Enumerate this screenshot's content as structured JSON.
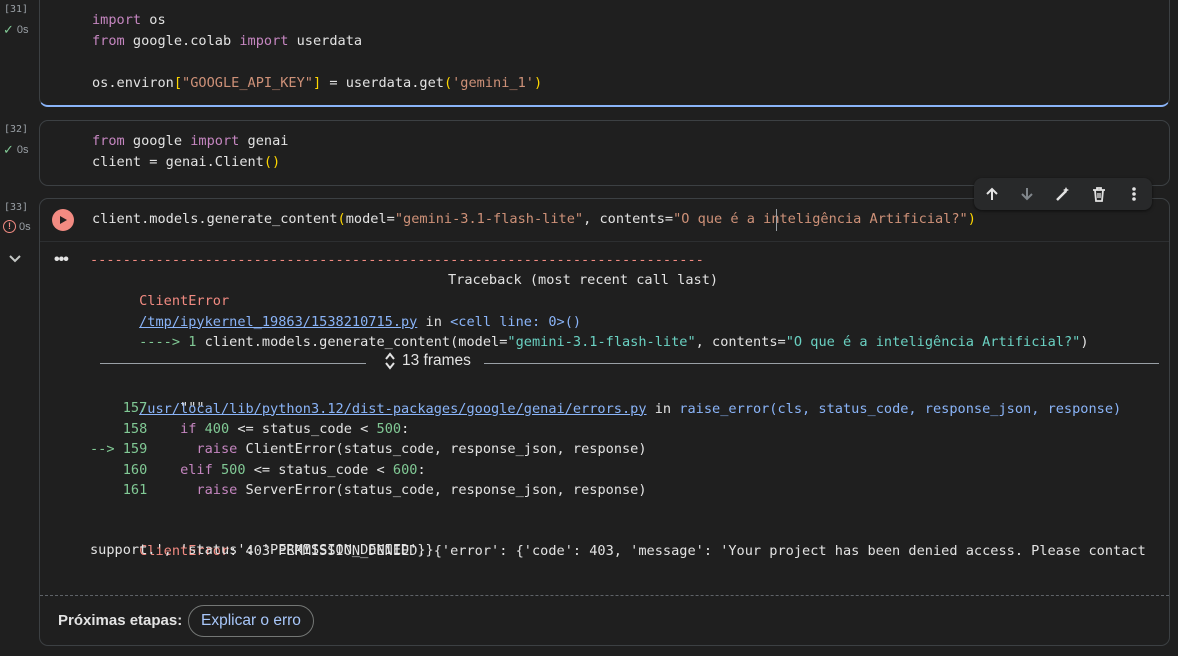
{
  "cells": [
    {
      "exec_count": "[31]",
      "time": "0s",
      "lines": [
        [
          [
            "kw",
            "import"
          ],
          [
            "plain",
            " os"
          ]
        ],
        [
          [
            "kw",
            "from"
          ],
          [
            "plain",
            " google.colab "
          ],
          [
            "kw",
            "import"
          ],
          [
            "plain",
            " userdata"
          ]
        ],
        [],
        [
          [
            "plain",
            "os.environ"
          ],
          [
            "br",
            "["
          ],
          [
            "str",
            "\"GOOGLE_API_KEY\""
          ],
          [
            "br",
            "]"
          ],
          [
            "plain",
            " = userdata.get"
          ],
          [
            "br",
            "("
          ],
          [
            "str",
            "'gemini_1'"
          ],
          [
            "br",
            ")"
          ]
        ]
      ]
    },
    {
      "exec_count": "[32]",
      "time": "0s",
      "lines": [
        [
          [
            "kw",
            "from"
          ],
          [
            "plain",
            " google "
          ],
          [
            "kw",
            "import"
          ],
          [
            "plain",
            " genai"
          ]
        ],
        [
          [
            "plain",
            "client = genai.Client"
          ],
          [
            "br",
            "()"
          ]
        ]
      ]
    },
    {
      "exec_count": "[33]",
      "time": "0s",
      "lines": [
        [
          [
            "plain",
            "client.models.generate_content"
          ],
          [
            "br",
            "("
          ],
          [
            "plain",
            "model="
          ],
          [
            "str",
            "\"gemini-3.1-flash-lite\""
          ],
          [
            "plain",
            ", contents="
          ],
          [
            "str",
            "\"O que é a inteligência Artificial?\""
          ],
          [
            "br",
            ")"
          ]
        ]
      ]
    }
  ],
  "output": {
    "dashes": "---------------------------------------------------------------------------",
    "error_name": "ClientError",
    "traceback_header": "Traceback (most recent call last)",
    "file_link_1": "/tmp/ipykernel_19863/1538210715.py",
    "in_1": " in ",
    "cell_ref": "<cell line: 0>()",
    "arrow_line_prefix": "----> 1 ",
    "arrow_line_code_a": "client.models.generate_content(model=",
    "arrow_line_str1": "\"gemini-3.1-flash-lite\"",
    "arrow_line_code_b": ", contents=",
    "arrow_line_str2": "\"O que é a inteligência Artificial?\"",
    "arrow_line_code_c": ")",
    "frames_label": "13 frames",
    "file_link_2": "/usr/local/lib/python3.12/dist-packages/google/genai/errors.py",
    "in_2": " in ",
    "func_sig": "raise_error(cls, status_code, response_json, response)",
    "src_lines": [
      {
        "marker": "    ",
        "num": "157",
        "code": [
          [
            "plain",
            "    \"\"\""
          ]
        ]
      },
      {
        "marker": "    ",
        "num": "158",
        "code": [
          [
            "plain",
            "    "
          ],
          [
            "kw",
            "if"
          ],
          [
            "plain",
            " "
          ],
          [
            "green",
            "400"
          ],
          [
            "plain",
            " <= status_code < "
          ],
          [
            "green",
            "500"
          ],
          [
            "plain",
            ":"
          ]
        ]
      },
      {
        "marker": "--> ",
        "num": "159",
        "code": [
          [
            "plain",
            "      "
          ],
          [
            "kw",
            "raise"
          ],
          [
            "plain",
            " ClientError(status_code, response_json, response)"
          ]
        ]
      },
      {
        "marker": "    ",
        "num": "160",
        "code": [
          [
            "plain",
            "    "
          ],
          [
            "kw",
            "elif"
          ],
          [
            "plain",
            " "
          ],
          [
            "green",
            "500"
          ],
          [
            "plain",
            " <= status_code < "
          ],
          [
            "green",
            "600"
          ],
          [
            "plain",
            ":"
          ]
        ]
      },
      {
        "marker": "    ",
        "num": "161",
        "code": [
          [
            "plain",
            "      "
          ],
          [
            "kw",
            "raise"
          ],
          [
            "plain",
            " ServerError(status_code, response_json, response)"
          ]
        ]
      }
    ],
    "final_error_name": "ClientError",
    "final_error_msg_1": ": 403 PERMISSION_DENIED. {'error': {'code': 403, 'message': 'Your project has been denied access. Please contact",
    "final_error_msg_2": "support.', 'status': 'PERMISSION_DENIED'}}"
  },
  "next_steps": {
    "label": "Próximas etapas:",
    "chip": "Explicar o erro"
  },
  "toolbar": [
    "arrow-up-icon",
    "arrow-down-icon",
    "magic-edit-icon",
    "trash-icon",
    "more-vert-icon"
  ],
  "colors": {
    "accent": "#8ab4f8",
    "error": "#f28b82",
    "run": "#f28b82"
  }
}
